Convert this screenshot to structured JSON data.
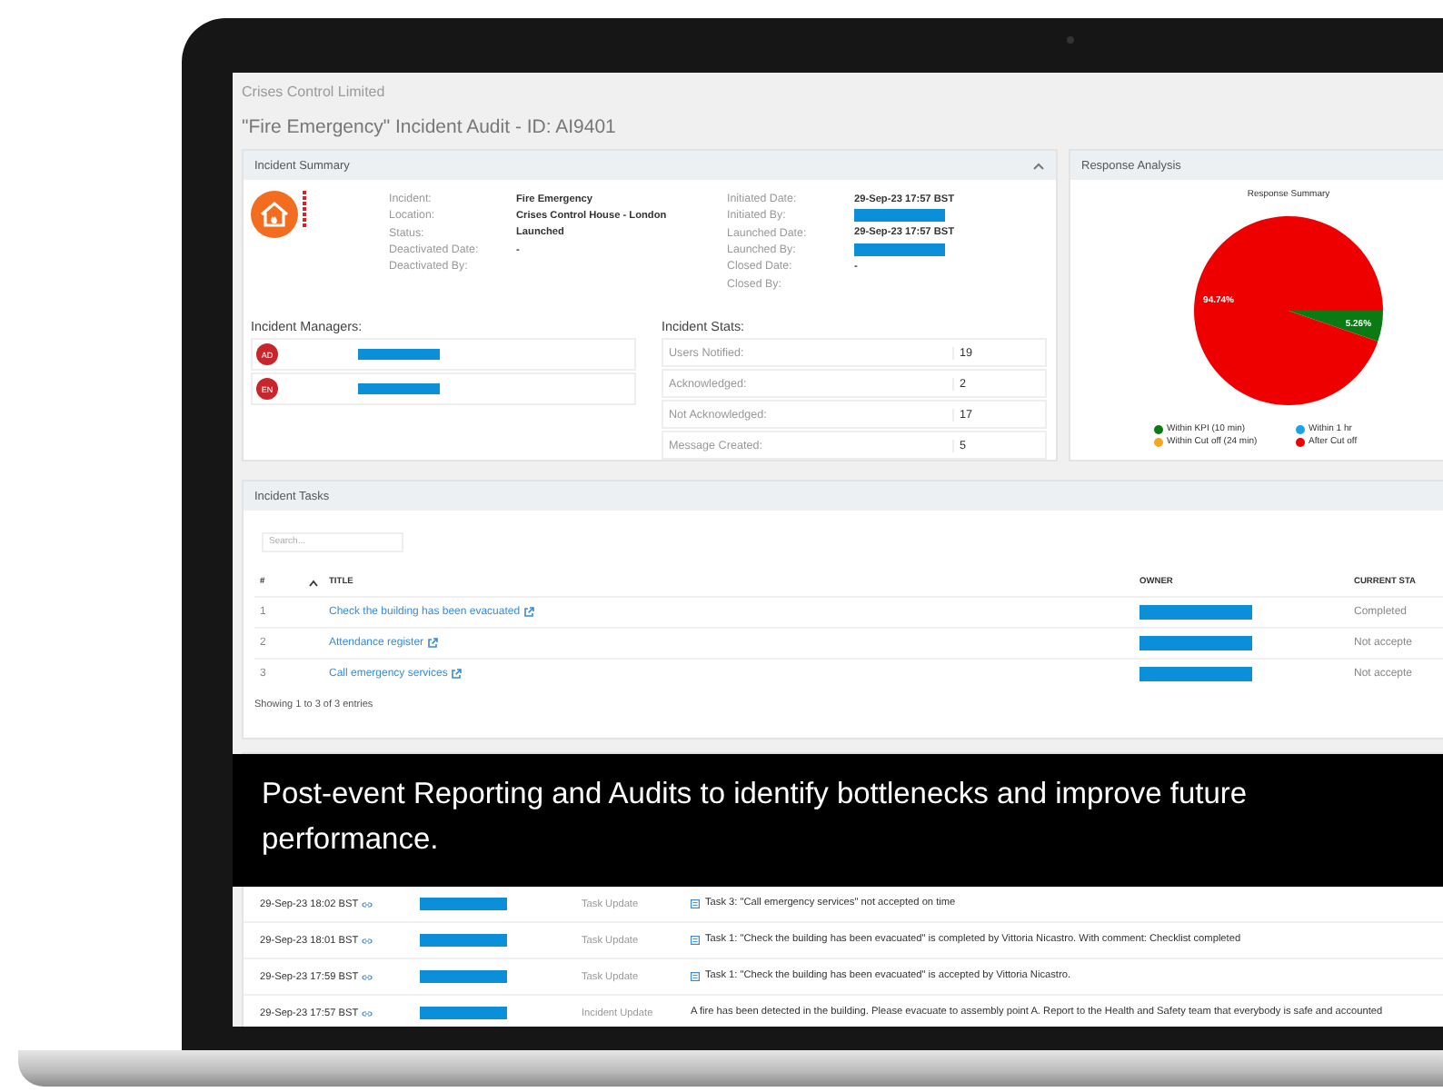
{
  "company": "Crises Control Limited",
  "page_title": "\"Fire Emergency\" Incident Audit - ID: AI9401",
  "incident_summary": {
    "title": "Incident Summary",
    "expanded": true,
    "details_left": [
      {
        "label": "Incident:",
        "kind": "text",
        "value": "Fire Emergency"
      },
      {
        "label": "Location:",
        "kind": "text",
        "value": "Crises Control House - London"
      },
      {
        "label": "Status:",
        "kind": "text",
        "value": "Launched"
      },
      {
        "label": "Deactivated Date:",
        "kind": "text",
        "value": "-"
      },
      {
        "label": "Deactivated By:",
        "kind": "empty"
      }
    ],
    "details_right": [
      {
        "label": "Initiated Date:",
        "kind": "text",
        "value": "29-Sep-23 17:57 BST"
      },
      {
        "label": "Initiated By:",
        "kind": "redacted"
      },
      {
        "label": "Launched Date:",
        "kind": "text",
        "value": "29-Sep-23 17:57 BST"
      },
      {
        "label": "Launched By:",
        "kind": "redacted"
      },
      {
        "label": "Closed Date:",
        "kind": "text",
        "value": "-"
      },
      {
        "label": "Closed By:",
        "kind": "empty"
      }
    ],
    "managers_title": "Incident Managers:",
    "managers": [
      {
        "initials": "AD"
      },
      {
        "initials": "EN"
      }
    ],
    "stats_title": "Incident Stats:",
    "stats": [
      {
        "label": "Users Notified:",
        "value": "19"
      },
      {
        "label": "Acknowledged:",
        "value": "2"
      },
      {
        "label": "Not Acknowledged:",
        "value": "17"
      },
      {
        "label": "Message Created:",
        "value": "5"
      }
    ]
  },
  "response_analysis": {
    "title": "Response Analysis",
    "chart_data": {
      "type": "pie",
      "title": "Response Summary",
      "categories": [
        "Within KPI (10 min)",
        "Within 1 hr",
        "Within Cut off (24 min)",
        "After Cut off"
      ],
      "values": [
        5.26,
        0,
        0,
        94.74
      ],
      "data_labels": true,
      "value_labels": [
        "5.26%",
        null,
        null,
        "94.74%"
      ],
      "legend": true
    }
  },
  "incident_tasks": {
    "title": "Incident Tasks",
    "search": {
      "placeholder": "Search..."
    },
    "columns": [
      "#",
      "TITLE",
      "OWNER",
      "CURRENT STA"
    ],
    "rows": [
      {
        "number": "1",
        "title": "Check the building has been evacuated",
        "status": "Completed"
      },
      {
        "number": "2",
        "title": "Attendance register",
        "status": "Not accepte"
      },
      {
        "number": "3",
        "title": "Call emergency services",
        "status": "Not accepte"
      }
    ],
    "footer": "Showing 1 to 3 of 3 entries"
  },
  "caption": "Post-event Reporting and Audits to identify bottlenecks and improve future performance.",
  "activity_log": [
    {
      "time": "29-Sep-23 18:02 BST",
      "type": "Task Update",
      "kind": "task",
      "message": "Task 3: \"Call emergency services\" not accepted on time"
    },
    {
      "time": "29-Sep-23 18:01 BST",
      "type": "Task Update",
      "kind": "task",
      "message": "Task 1: \"Check the building has been evacuated\" is completed by Vittoria Nicastro. With comment: Checklist completed"
    },
    {
      "time": "29-Sep-23 17:59 BST",
      "type": "Task Update",
      "kind": "task",
      "message": "Task 1: \"Check the building has been evacuated\" is accepted by Vittoria Nicastro."
    },
    {
      "time": "29-Sep-23 17:57 BST",
      "type": "Incident Update",
      "kind": "incident",
      "message": "A fire has been detected in the building. Please evacuate to assembly point A. Report to the Health and Safety team that everybody is safe and accounted"
    }
  ]
}
